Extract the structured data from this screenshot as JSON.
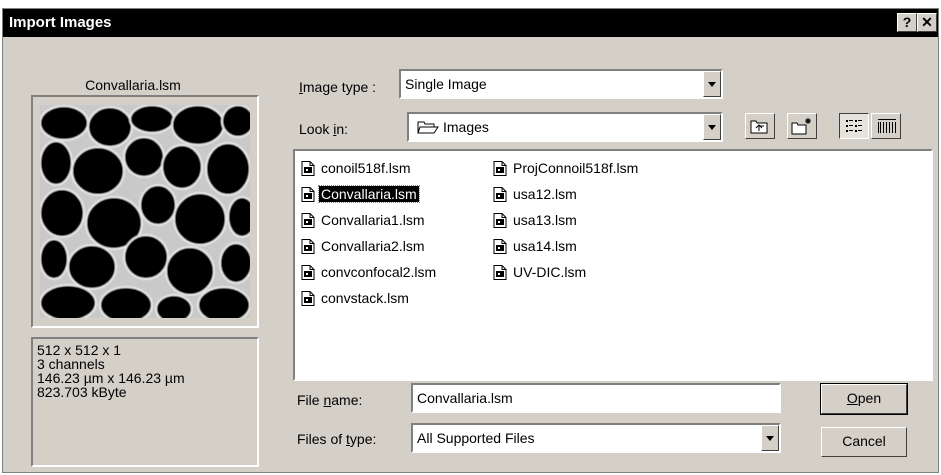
{
  "window": {
    "title": "Import Images",
    "help_button": "?",
    "close_button": "✕"
  },
  "preview": {
    "filename": "Convallaria.lsm",
    "info_lines": [
      "512 x 512 x 1",
      "3 channels",
      "146.23 µm x 146.23 µm",
      "823.703 kByte"
    ]
  },
  "image_type": {
    "label_pre": "",
    "label_accel": "I",
    "label_post": "mage type :",
    "value": "Single Image"
  },
  "look_in": {
    "label_pre": "Look ",
    "label_accel": "i",
    "label_post": "n:",
    "value": "Images",
    "icon": "folder-open-icon"
  },
  "toolbar": {
    "up_folder_icon": "up-folder-icon",
    "new_folder_icon": "new-folder-icon",
    "list_view_icon": "list-view-icon",
    "details_view_icon": "details-view-icon"
  },
  "files": {
    "column1": [
      "conoil518f.lsm",
      "Convallaria.lsm",
      "Convallaria1.lsm",
      "Convallaria2.lsm",
      "convconfocal2.lsm",
      "convstack.lsm"
    ],
    "column2": [
      "ProjConnoil518f.lsm",
      "usa12.lsm",
      "usa13.lsm",
      "usa14.lsm",
      "UV-DIC.lsm"
    ],
    "selected": "Convallaria.lsm",
    "icon": "lsm-file-icon"
  },
  "file_name": {
    "label_pre": "File ",
    "label_accel": "n",
    "label_post": "ame:",
    "value": "Convallaria.lsm"
  },
  "files_of_type": {
    "label_pre": "Files of ",
    "label_accel": "t",
    "label_post": "ype:",
    "value": "All Supported Files"
  },
  "buttons": {
    "open_accel": "O",
    "open_rest": "pen",
    "cancel": "Cancel"
  }
}
